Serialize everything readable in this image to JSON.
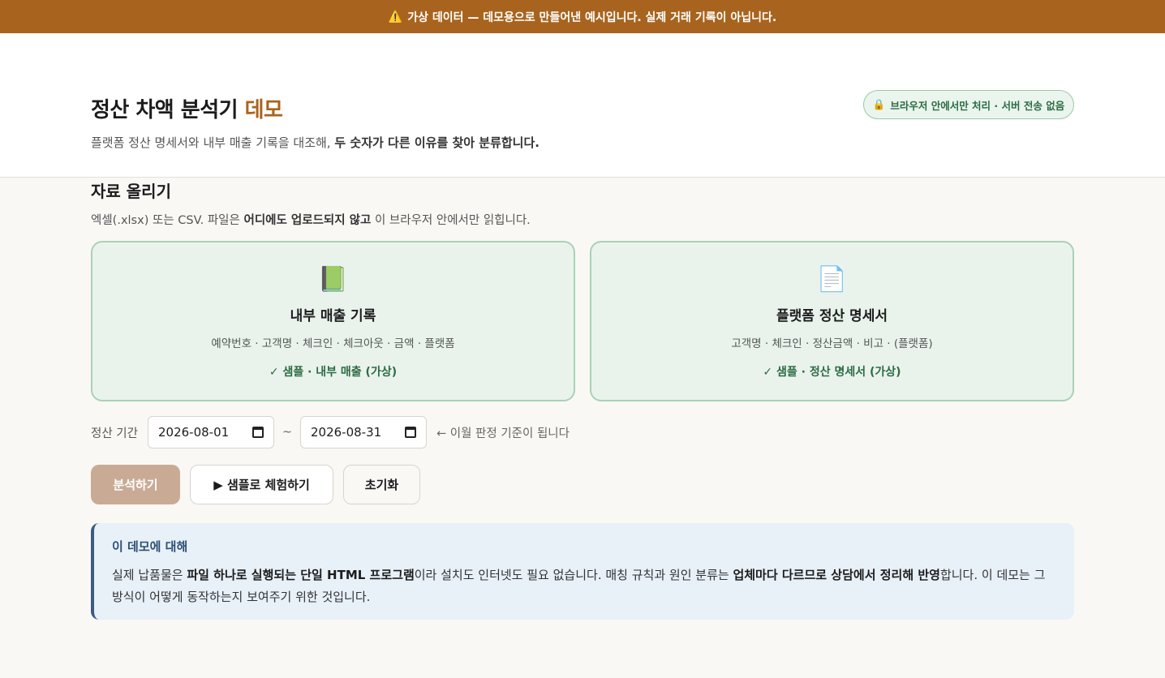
{
  "banner": {
    "icon": "warning-icon",
    "text": "가상 데이터 — 데모용으로 만들어낸 예시입니다. 실제 거래 기록이 아닙니다."
  },
  "header": {
    "title_main": "정산 차액 분석기",
    "title_accent": "데모",
    "subtitle_plain": "플랫폼 정산 명세서와 내부 매출 기록을 대조해,",
    "subtitle_bold": "두 숫자가 다른 이유를 찾아 분류합니다.",
    "privacy_icon": "lock-icon",
    "privacy_text": "브라우저 안에서만 처리 · 서버 전송 없음"
  },
  "upload": {
    "title": "자료 올리기",
    "desc_before": "엑셀(.xlsx) 또는 CSV. 파일은",
    "desc_bold": "어디에도 업로드되지 않고",
    "desc_after": "이 브라우저 안에서만 읽힙니다.",
    "cards": [
      {
        "icon": "green-book-icon",
        "glyph": "📗",
        "title": "내부 매출 기록",
        "fields": "예약번호 · 고객명 · 체크인 · 체크아웃 · 금액 · 플랫폼",
        "status": "✓ 샘플 · 내부 매출 (가상)"
      },
      {
        "icon": "document-icon",
        "glyph": "📄",
        "title": "플랫폼 정산 명세서",
        "fields": "고객명 · 체크인 · 정산금액 · 비고 · (플랫폼)",
        "status": "✓ 샘플 · 정산 명세서 (가상)"
      }
    ]
  },
  "period": {
    "label": "정산 기간",
    "start": "2026-08-01",
    "separator": "~",
    "end": "2026-08-31",
    "hint": "← 이월 판정 기준이 됩니다"
  },
  "buttons": {
    "analyze": "분석하기",
    "sample": "▶ 샘플로 체험하기",
    "reset": "초기화"
  },
  "info": {
    "title": "이 데모에 대해",
    "p1": "실제 납품물은",
    "b1": "파일 하나로 실행되는 단일 HTML 프로그램",
    "p2": "이라 설치도 인터넷도 필요 없습니다. 매칭 규칙과 원인 분류는",
    "b2": "업체마다 다르므로 상담에서 정리해 반영",
    "p3": "합니다. 이 데모는 그 방식이 어떻게 동작하는지 보여주기 위한 것입니다."
  }
}
